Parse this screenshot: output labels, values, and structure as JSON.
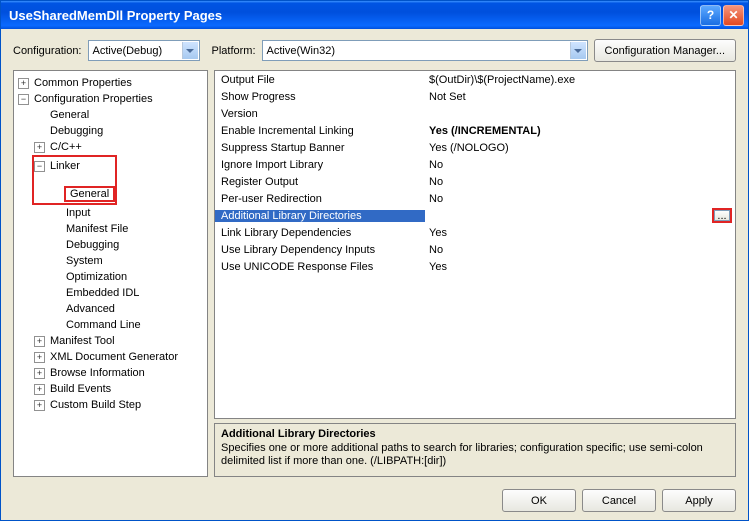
{
  "window": {
    "title": "UseSharedMemDll Property Pages"
  },
  "labels": {
    "configuration": "Configuration:",
    "platform": "Platform:",
    "config_mgr": "Configuration Manager..."
  },
  "combos": {
    "configuration": "Active(Debug)",
    "platform": "Active(Win32)"
  },
  "tree": {
    "common": "Common Properties",
    "config": "Configuration Properties",
    "general0": "General",
    "debugging": "Debugging",
    "ccpp": "C/C++",
    "linker": "Linker",
    "l_general": "General",
    "l_input": "Input",
    "l_manifest": "Manifest File",
    "l_debug": "Debugging",
    "l_system": "System",
    "l_opt": "Optimization",
    "l_idl": "Embedded IDL",
    "l_adv": "Advanced",
    "l_cmd": "Command Line",
    "manifest_tool": "Manifest Tool",
    "xmldoc": "XML Document Generator",
    "browse": "Browse Information",
    "buildev": "Build Events",
    "custom": "Custom Build Step"
  },
  "grid": {
    "rows": [
      {
        "name": "Output File",
        "val": "$(OutDir)\\$(ProjectName).exe"
      },
      {
        "name": "Show Progress",
        "val": "Not Set"
      },
      {
        "name": "Version",
        "val": ""
      },
      {
        "name": "Enable Incremental Linking",
        "val": "Yes (/INCREMENTAL)",
        "bold": true
      },
      {
        "name": "Suppress Startup Banner",
        "val": "Yes (/NOLOGO)"
      },
      {
        "name": "Ignore Import Library",
        "val": "No"
      },
      {
        "name": "Register Output",
        "val": "No"
      },
      {
        "name": "Per-user Redirection",
        "val": "No"
      },
      {
        "name": "Additional Library Directories",
        "val": "",
        "selected": true
      },
      {
        "name": "Link Library Dependencies",
        "val": "Yes"
      },
      {
        "name": "Use Library Dependency Inputs",
        "val": "No"
      },
      {
        "name": "Use UNICODE Response Files",
        "val": "Yes"
      }
    ]
  },
  "desc": {
    "title": "Additional Library Directories",
    "text": "Specifies one or more additional paths to search for libraries; configuration specific; use semi-colon delimited list if more than one.    (/LIBPATH:[dir])"
  },
  "buttons": {
    "ok": "OK",
    "cancel": "Cancel",
    "apply": "Apply"
  },
  "ellipsis": "..."
}
